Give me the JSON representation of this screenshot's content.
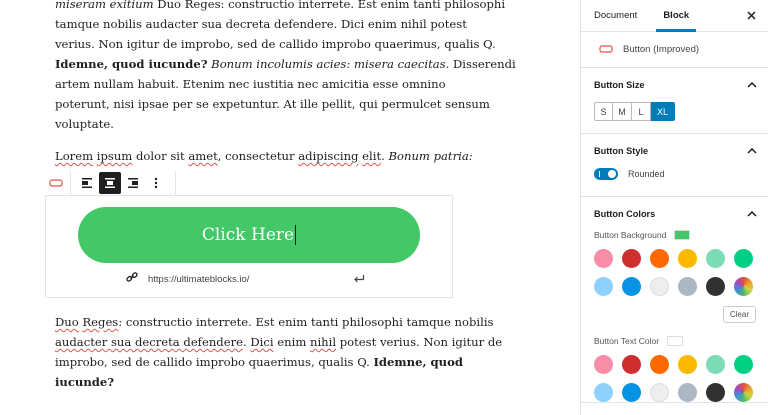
{
  "editor": {
    "para1": {
      "l1": {
        "a": "miseram exitium",
        "b": " Duo Reges: constructio interrete. Est enim tanti philosophi"
      },
      "l2": "tamque nobilis audacter sua decreta defendere. Dici enim nihil potest",
      "l3": "verius. Non igitur de improbo, sed de callido improbo quaerimus, qualis Q.",
      "l4": {
        "bold": "Idemne, quod iucunde?",
        "italic": " Bonum incolumis acies: misera caecitas.",
        "rest": " Disserendi"
      },
      "l5": "artem nullam habuit. Etenim nec iustitia nec amicitia esse omnino",
      "l6": "poterunt, nisi ipsae per se expetuntur. At ille pellit, qui permulcet sensum",
      "l7": "voluptate."
    },
    "para2": {
      "w1": "Lorem",
      "w2": "ipsum",
      "w3": "dolor sit",
      "w4": "amet",
      "w5": ", consectetur",
      "w6": "adipiscing",
      "w7": "elit",
      "w8": ".",
      "italic": " Bonum patria:"
    },
    "button": {
      "text": "Click Here",
      "url": "https://ultimateblocks.io/"
    },
    "para3": {
      "l1": {
        "a": "Duo",
        "b": "Reges",
        "c": ": constructio interrete. Est enim tanti philosophi tamque nobilis"
      },
      "l2": {
        "a": "audacter sua decreta defendere",
        "b": ".",
        "c": " ",
        "d": "Dici",
        "e": " enim ",
        "f": "nihil",
        "g": " potest verius. Non igitur de"
      },
      "l3": {
        "a": "improbo, sed de callido improbo quaerimus, qualis Q. ",
        "bold": "Idemne, quod"
      },
      "l4": {
        "bold": "iucunde?"
      }
    }
  },
  "sidebar": {
    "tabs": [
      {
        "label": "Document"
      },
      {
        "label": "Block"
      }
    ],
    "block_name": "Button (Improved)",
    "panels": {
      "size": {
        "title": "Button Size",
        "options": [
          "S",
          "M",
          "L",
          "XL"
        ],
        "selected": "XL"
      },
      "style": {
        "title": "Button Style",
        "toggle_label": "Rounded"
      },
      "colors": {
        "title": "Button Colors",
        "background_label": "Button Background",
        "background_value": "#44c767",
        "text_label": "Button Text Color",
        "text_value": "#ffffff",
        "clear_label": "Clear",
        "palette": [
          "#f78da7",
          "#cf2e2e",
          "#ff6900",
          "#fcb900",
          "#7bdcb5",
          "#00d084",
          "#8ed1fc",
          "#0693e3",
          "#eeeeee",
          "#abb8c3",
          "#313131",
          "conic"
        ]
      }
    }
  }
}
